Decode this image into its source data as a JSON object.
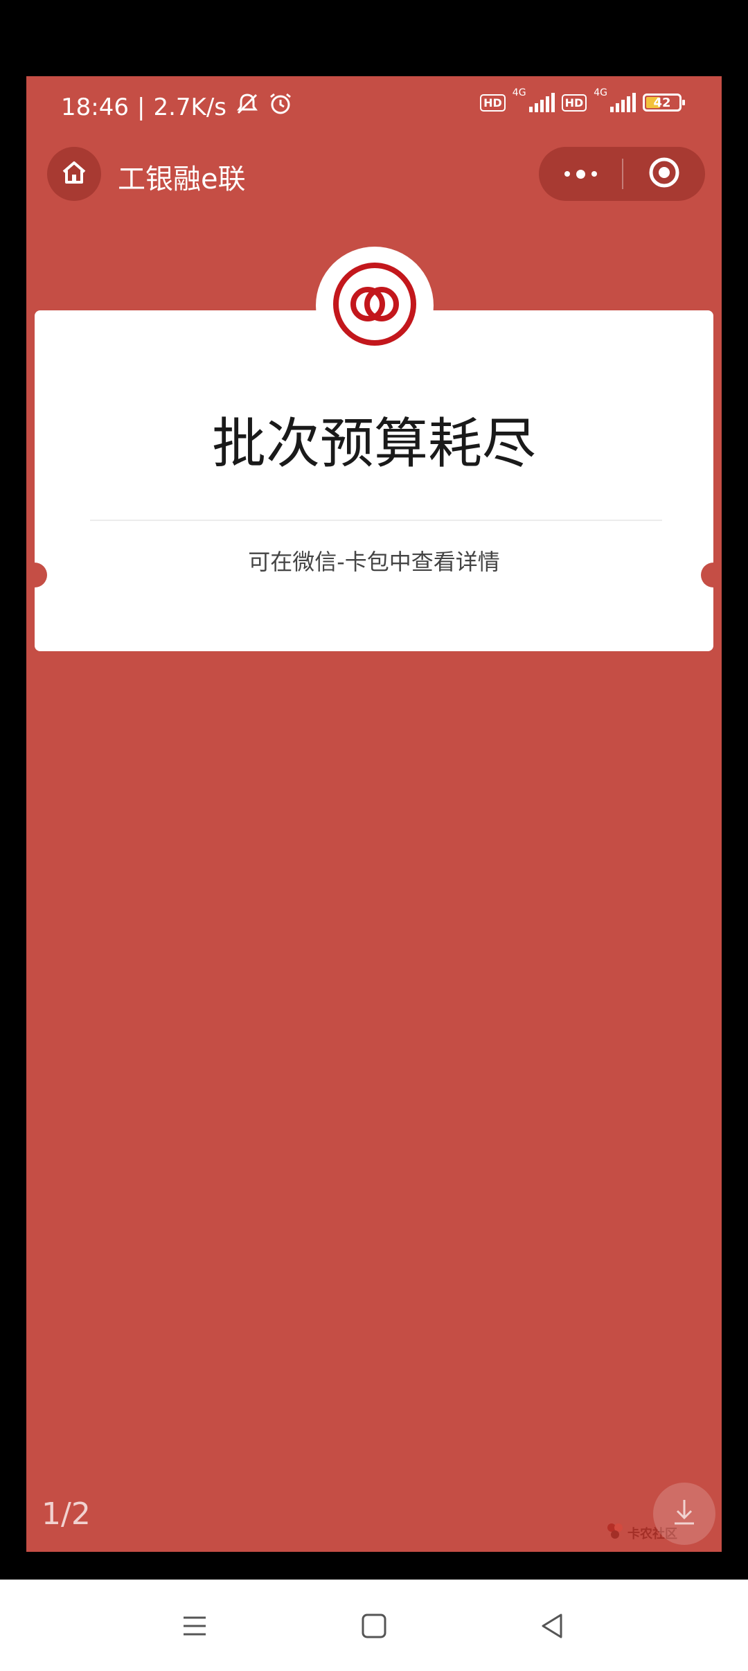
{
  "status_bar": {
    "time": "18:46",
    "separator": "|",
    "net_speed": "2.7K/s",
    "hd1": "HD",
    "net1": "4G",
    "hd2": "HD",
    "net2": "4G",
    "battery": "42",
    "icons": [
      "mute-bell-icon",
      "alarm-icon",
      "signal-icon",
      "battery-icon"
    ]
  },
  "header": {
    "title": "工银融e联",
    "icons": [
      "home-icon",
      "more-dots-icon",
      "close-target-icon"
    ]
  },
  "card": {
    "title": "批次预算耗尽",
    "subtitle": "可在微信-卡包中查看详情",
    "icon": "icbc-logo-icon"
  },
  "overlay": {
    "page_indicator": "1/2",
    "watermark": "卡农社区",
    "icons": [
      "download-icon"
    ]
  },
  "system_nav": {
    "icons": [
      "menu-icon",
      "home-square-icon",
      "back-triangle-icon"
    ]
  },
  "colors": {
    "background_red": "#c54e45",
    "logo_red": "#c3171c",
    "card_white": "#ffffff"
  }
}
